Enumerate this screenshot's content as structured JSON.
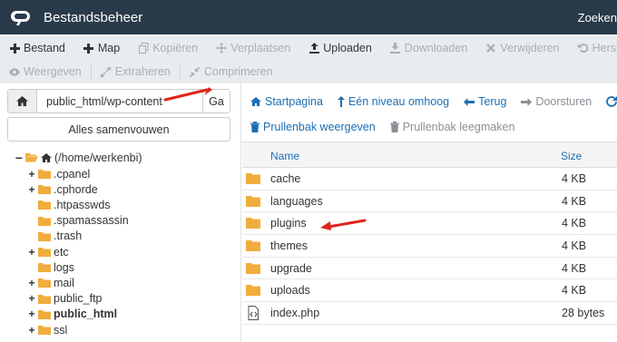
{
  "header": {
    "title": "Bestandsbeheer",
    "search_label": "Zoeken"
  },
  "toolbar": {
    "row1": [
      {
        "label": "Bestand",
        "icon": "plus-icon",
        "enabled": true
      },
      {
        "label": "Map",
        "icon": "plus-icon",
        "enabled": true
      },
      {
        "label": "Kopiëren",
        "icon": "copy-icon",
        "enabled": false
      },
      {
        "label": "Verplaatsen",
        "icon": "move-icon",
        "enabled": false
      },
      {
        "label": "Uploaden",
        "icon": "upload-icon",
        "enabled": true
      },
      {
        "label": "Downloaden",
        "icon": "download-icon",
        "enabled": false
      },
      {
        "label": "Verwijderen",
        "icon": "times-icon",
        "enabled": false
      },
      {
        "label": "Herstellen",
        "icon": "undo-icon",
        "enabled": false
      }
    ],
    "row2": [
      {
        "label": "Weergeven",
        "icon": "eye-icon",
        "enabled": false
      },
      {
        "label": "Extraheren",
        "icon": "expand-icon",
        "enabled": false
      },
      {
        "label": "Comprimeren",
        "icon": "compress-icon",
        "enabled": false
      }
    ]
  },
  "path": {
    "value": "public_html/wp-content",
    "go_label": "Ga"
  },
  "collapse_label": "Alles samenvouwen",
  "tree": {
    "root": "(/home/werkenbi)",
    "items": [
      {
        "label": ".cpanel",
        "toggle": "+",
        "bold": false
      },
      {
        "label": ".cphorde",
        "toggle": "+",
        "bold": false
      },
      {
        "label": ".htpasswds",
        "toggle": "",
        "bold": false
      },
      {
        "label": ".spamassassin",
        "toggle": "",
        "bold": false
      },
      {
        "label": ".trash",
        "toggle": "",
        "bold": false
      },
      {
        "label": "etc",
        "toggle": "+",
        "bold": false
      },
      {
        "label": "logs",
        "toggle": "",
        "bold": false
      },
      {
        "label": "mail",
        "toggle": "+",
        "bold": false
      },
      {
        "label": "public_ftp",
        "toggle": "+",
        "bold": false
      },
      {
        "label": "public_html",
        "toggle": "+",
        "bold": true
      },
      {
        "label": "ssl",
        "toggle": "+",
        "bold": false
      }
    ]
  },
  "nav": {
    "home": "Startpagina",
    "up": "Eén niveau omhoog",
    "back": "Terug",
    "forward": "Doorsturen",
    "trash_view": "Prullenbak weergeven",
    "trash_empty": "Prullenbak leegmaken"
  },
  "table": {
    "col_name": "Name",
    "col_size": "Size",
    "rows": [
      {
        "name": "cache",
        "size": "4 KB",
        "type": "folder"
      },
      {
        "name": "languages",
        "size": "4 KB",
        "type": "folder"
      },
      {
        "name": "plugins",
        "size": "4 KB",
        "type": "folder"
      },
      {
        "name": "themes",
        "size": "4 KB",
        "type": "folder"
      },
      {
        "name": "upgrade",
        "size": "4 KB",
        "type": "folder"
      },
      {
        "name": "uploads",
        "size": "4 KB",
        "type": "folder"
      },
      {
        "name": "index.php",
        "size": "28 bytes",
        "type": "php-file"
      }
    ]
  },
  "colors": {
    "header_bg": "#293a4a",
    "toolbar_bg": "#e9ecef",
    "link": "#1c6fb3",
    "folder": "#f0ad3c",
    "annotation_arrow": "#e0241b"
  }
}
